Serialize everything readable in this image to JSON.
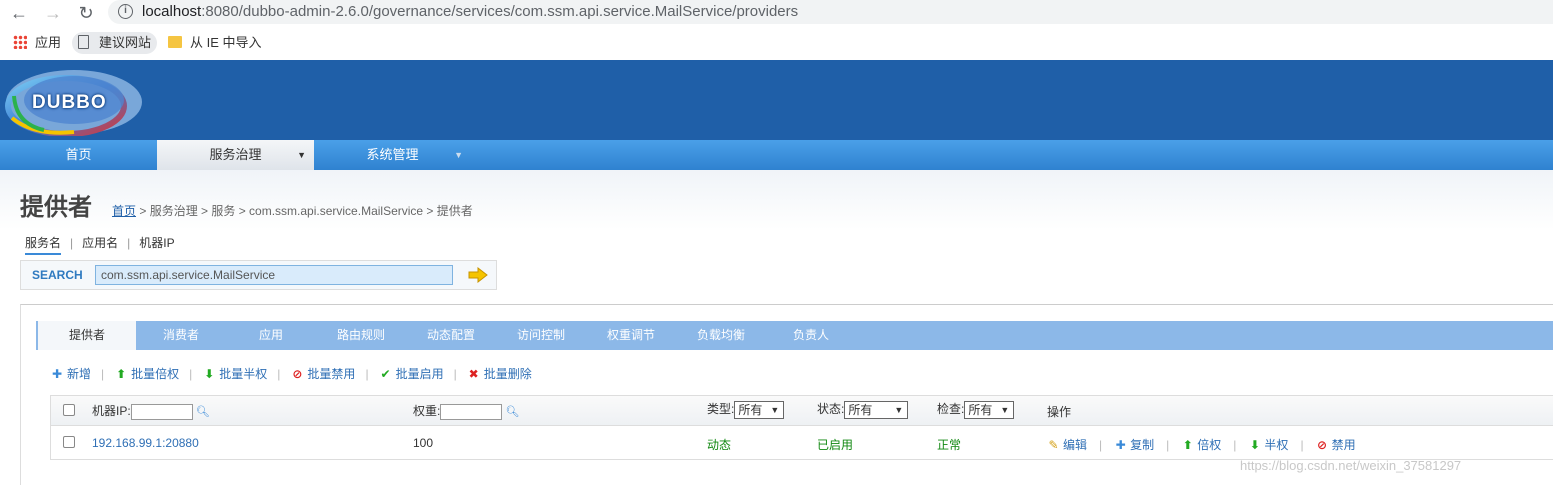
{
  "browser": {
    "url_host": "localhost",
    "url_rest": ":8080/dubbo-admin-2.6.0/governance/services/com.ssm.api.service.MailService/providers",
    "bookmarks": [
      "应用",
      "建议网站",
      "从 IE 中导入"
    ]
  },
  "app": {
    "logo_text": "DUBBO"
  },
  "menu": [
    {
      "label": "首页"
    },
    {
      "label": "服务治理",
      "active": true,
      "caret": "▼"
    },
    {
      "label": "系统管理",
      "caret": "▼"
    }
  ],
  "page": {
    "title": "提供者",
    "breadcrumb": {
      "home": "首页",
      "rest": " > 服务治理 > 服务 > com.ssm.api.service.MailService > 提供者"
    }
  },
  "search": {
    "tabs": [
      "服务名",
      "应用名",
      "机器IP"
    ],
    "separator": "|",
    "label": "SEARCH",
    "value": "com.ssm.api.service.MailService"
  },
  "tabs": [
    "提供者",
    "消费者",
    "应用",
    "路由规则",
    "动态配置",
    "访问控制",
    "权重调节",
    "负载均衡",
    "负责人"
  ],
  "toolbar": [
    {
      "icon": "✚",
      "label": "新增",
      "color": "#3a8ad8"
    },
    {
      "icon": "⬆",
      "label": "批量倍权",
      "color": "#22aa22"
    },
    {
      "icon": "⬇",
      "label": "批量半权",
      "color": "#22aa22"
    },
    {
      "icon": "⊘",
      "label": "批量禁用",
      "color": "#dd2222"
    },
    {
      "icon": "✔",
      "label": "批量启用",
      "color": "#22aa22"
    },
    {
      "icon": "✖",
      "label": "批量删除",
      "color": "#dd2222"
    }
  ],
  "grid": {
    "headers": {
      "ip": "机器IP:",
      "weight": "权重:",
      "type": "类型:",
      "status": "状态:",
      "check": "检查:",
      "ops": "操作"
    },
    "filters": {
      "type": "所有",
      "status": "所有",
      "check": "所有"
    },
    "rows": [
      {
        "ip": "192.168.99.1:20880",
        "weight": "100",
        "type": "动态",
        "status": "已启用",
        "check": "正常"
      }
    ],
    "row_ops": [
      {
        "icon": "✎",
        "label": "编辑",
        "color": "#d4a017"
      },
      {
        "icon": "✚",
        "label": "复制",
        "color": "#3a8ad8"
      },
      {
        "icon": "⬆",
        "label": "倍权",
        "color": "#22aa22"
      },
      {
        "icon": "⬇",
        "label": "半权",
        "color": "#22aa22"
      },
      {
        "icon": "⊘",
        "label": "禁用",
        "color": "#dd2222"
      }
    ]
  },
  "watermark": "https://blog.csdn.net/weixin_37581297"
}
